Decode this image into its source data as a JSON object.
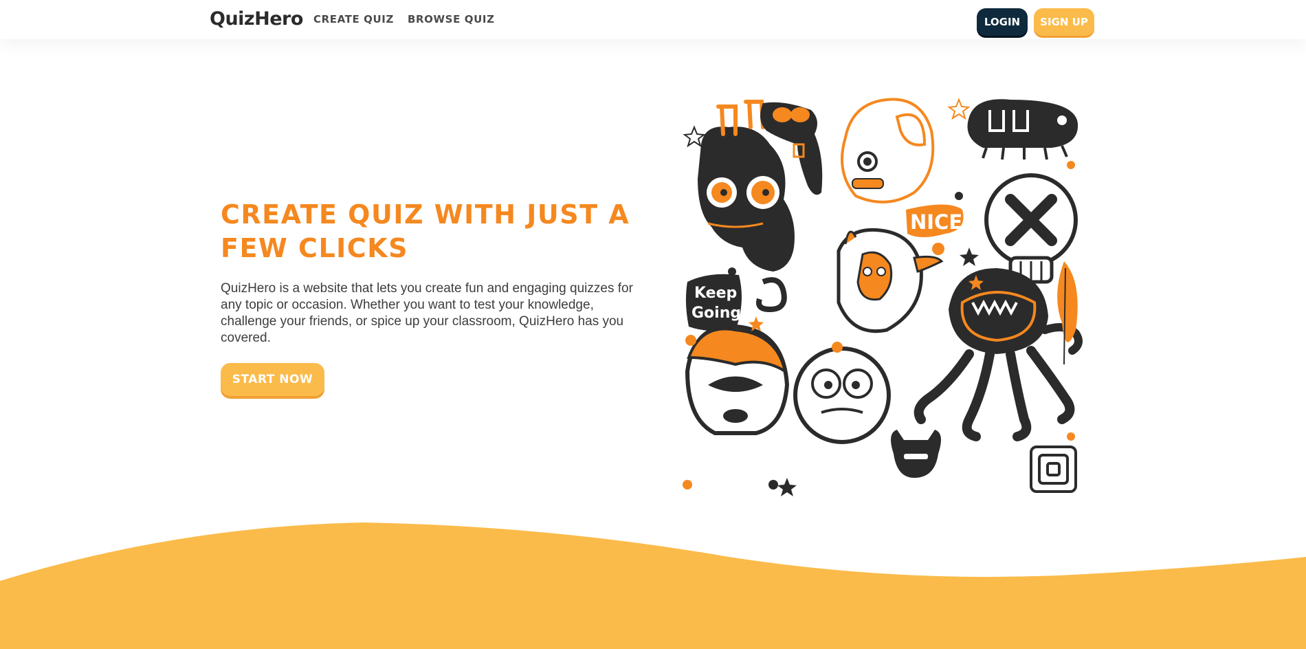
{
  "header": {
    "logo": "QuizHero",
    "nav": {
      "create_quiz": "CREATE QUIZ",
      "browse_quiz": "BROWSE QUIZ"
    },
    "login_label": "LOGIN",
    "signup_label": "SIGN UP"
  },
  "hero": {
    "title": "CREATE QUIZ WITH JUST A FEW CLICKS",
    "description": "QuizHero is a website that lets you create fun and engaging quizzes for any topic or occasion. Whether you want to test your knowledge, challenge your friends, or spice up your classroom, QuizHero has you covered.",
    "cta_label": "START NOW"
  },
  "illustration": {
    "nice_label": "NICE",
    "keep_going_line1": "Keep",
    "keep_going_line2": "Going"
  },
  "colors": {
    "accent_orange": "#f5881f",
    "button_yellow": "#fbbb4a",
    "login_navy": "#0f2a3d",
    "wave_yellow": "#fbbb4a",
    "ink": "#2b2b2b"
  },
  "icons": [
    "monster-illustration"
  ]
}
